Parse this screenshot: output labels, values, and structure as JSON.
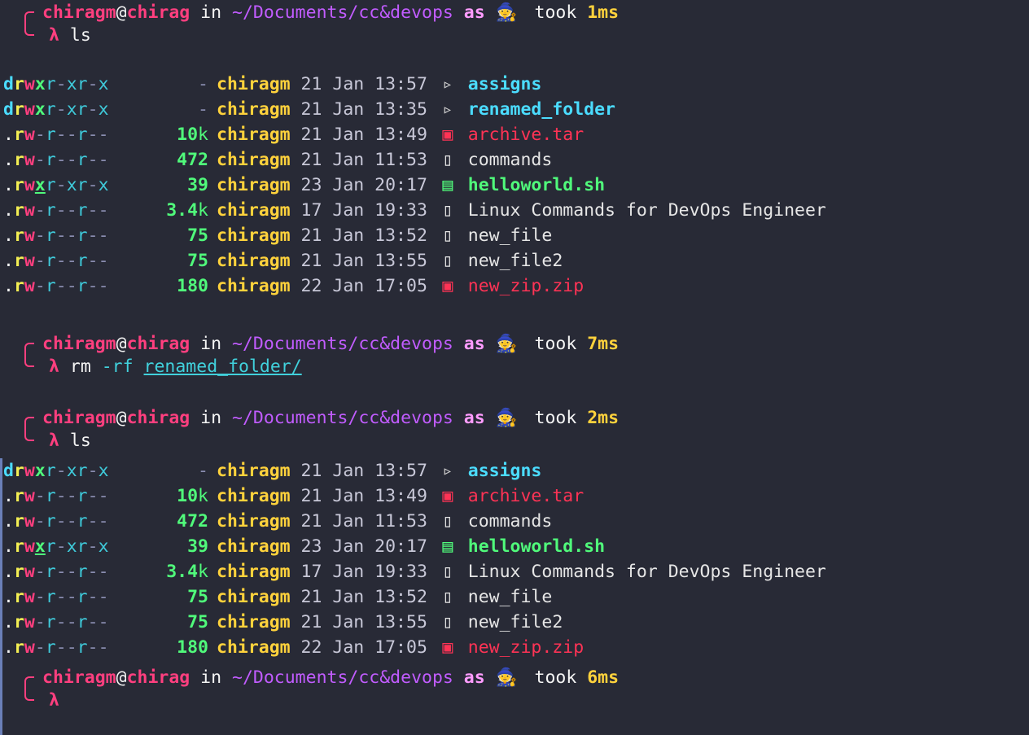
{
  "prompts": [
    {
      "user": "chiragm",
      "host": "chirag",
      "path": "~/Documents/cc&devops",
      "as": "as",
      "took": "took",
      "duration": "1ms",
      "command": "ls",
      "args": ""
    },
    {
      "user": "chiragm",
      "host": "chirag",
      "path": "~/Documents/cc&devops",
      "as": "as",
      "took": "took",
      "duration": "7ms",
      "command": "rm",
      "flag": "-rf",
      "args": "renamed_folder/"
    },
    {
      "user": "chiragm",
      "host": "chirag",
      "path": "~/Documents/cc&devops",
      "as": "as",
      "took": "took",
      "duration": "2ms",
      "command": "ls",
      "args": ""
    },
    {
      "user": "chiragm",
      "host": "chirag",
      "path": "~/Documents/cc&devops",
      "as": "as",
      "took": "took",
      "duration": "6ms",
      "command": "",
      "args": ""
    }
  ],
  "listing1": [
    {
      "perm": "drwxr-xr-x",
      "size": "-",
      "owner": "chiragm",
      "date": "21 Jan 13:57",
      "icon": "folder-icon",
      "name": "assigns",
      "kind": "dir"
    },
    {
      "perm": "drwxr-xr-x",
      "size": "-",
      "owner": "chiragm",
      "date": "21 Jan 13:35",
      "icon": "folder-icon",
      "name": "renamed_folder",
      "kind": "dir"
    },
    {
      "perm": ".rw-r--r--",
      "size": "10k",
      "owner": "chiragm",
      "date": "21 Jan 13:49",
      "icon": "archive-icon",
      "name": "archive.tar",
      "kind": "arc"
    },
    {
      "perm": ".rw-r--r--",
      "size": "472",
      "owner": "chiragm",
      "date": "21 Jan 11:53",
      "icon": "document-icon",
      "name": "commands",
      "kind": "plain"
    },
    {
      "perm": ".rwxr-xr-x",
      "size": "39",
      "owner": "chiragm",
      "date": "23 Jan 20:17",
      "icon": "script-icon",
      "name": "helloworld.sh",
      "kind": "exe"
    },
    {
      "perm": ".rw-r--r--",
      "size": "3.4k",
      "owner": "chiragm",
      "date": "17 Jan 19:33",
      "icon": "document-icon",
      "name": "Linux Commands for DevOps Engineer",
      "kind": "plain"
    },
    {
      "perm": ".rw-r--r--",
      "size": "75",
      "owner": "chiragm",
      "date": "21 Jan 13:52",
      "icon": "document-icon",
      "name": "new_file",
      "kind": "plain"
    },
    {
      "perm": ".rw-r--r--",
      "size": "75",
      "owner": "chiragm",
      "date": "21 Jan 13:55",
      "icon": "document-icon",
      "name": "new_file2",
      "kind": "plain"
    },
    {
      "perm": ".rw-r--r--",
      "size": "180",
      "owner": "chiragm",
      "date": "22 Jan 17:05",
      "icon": "archive-icon",
      "name": "new_zip.zip",
      "kind": "arc"
    }
  ],
  "listing2": [
    {
      "perm": "drwxr-xr-x",
      "size": "-",
      "owner": "chiragm",
      "date": "21 Jan 13:57",
      "icon": "folder-icon",
      "name": "assigns",
      "kind": "dir"
    },
    {
      "perm": ".rw-r--r--",
      "size": "10k",
      "owner": "chiragm",
      "date": "21 Jan 13:49",
      "icon": "archive-icon",
      "name": "archive.tar",
      "kind": "arc"
    },
    {
      "perm": ".rw-r--r--",
      "size": "472",
      "owner": "chiragm",
      "date": "21 Jan 11:53",
      "icon": "document-icon",
      "name": "commands",
      "kind": "plain"
    },
    {
      "perm": ".rwxr-xr-x",
      "size": "39",
      "owner": "chiragm",
      "date": "23 Jan 20:17",
      "icon": "script-icon",
      "name": "helloworld.sh",
      "kind": "exe"
    },
    {
      "perm": ".rw-r--r--",
      "size": "3.4k",
      "owner": "chiragm",
      "date": "17 Jan 19:33",
      "icon": "document-icon",
      "name": "Linux Commands for DevOps Engineer",
      "kind": "plain"
    },
    {
      "perm": ".rw-r--r--",
      "size": "75",
      "owner": "chiragm",
      "date": "21 Jan 13:52",
      "icon": "document-icon",
      "name": "new_file",
      "kind": "plain"
    },
    {
      "perm": ".rw-r--r--",
      "size": "75",
      "owner": "chiragm",
      "date": "21 Jan 13:55",
      "icon": "document-icon",
      "name": "new_file2",
      "kind": "plain"
    },
    {
      "perm": ".rw-r--r--",
      "size": "180",
      "owner": "chiragm",
      "date": "22 Jan 17:05",
      "icon": "archive-icon",
      "name": "new_zip.zip",
      "kind": "arc"
    }
  ],
  "glyphs": {
    "lambda": "λ",
    "wizard": "🧙",
    "folder": "▹",
    "archive": "▣",
    "script": "▤",
    "document": "▯"
  },
  "colors": {
    "background": "#282a36",
    "user": "#ff3f7f",
    "path": "#c15cff",
    "duration": "#ffd23c",
    "dir": "#4bdcff",
    "exec": "#50fa7b",
    "archive": "#ff3355"
  }
}
